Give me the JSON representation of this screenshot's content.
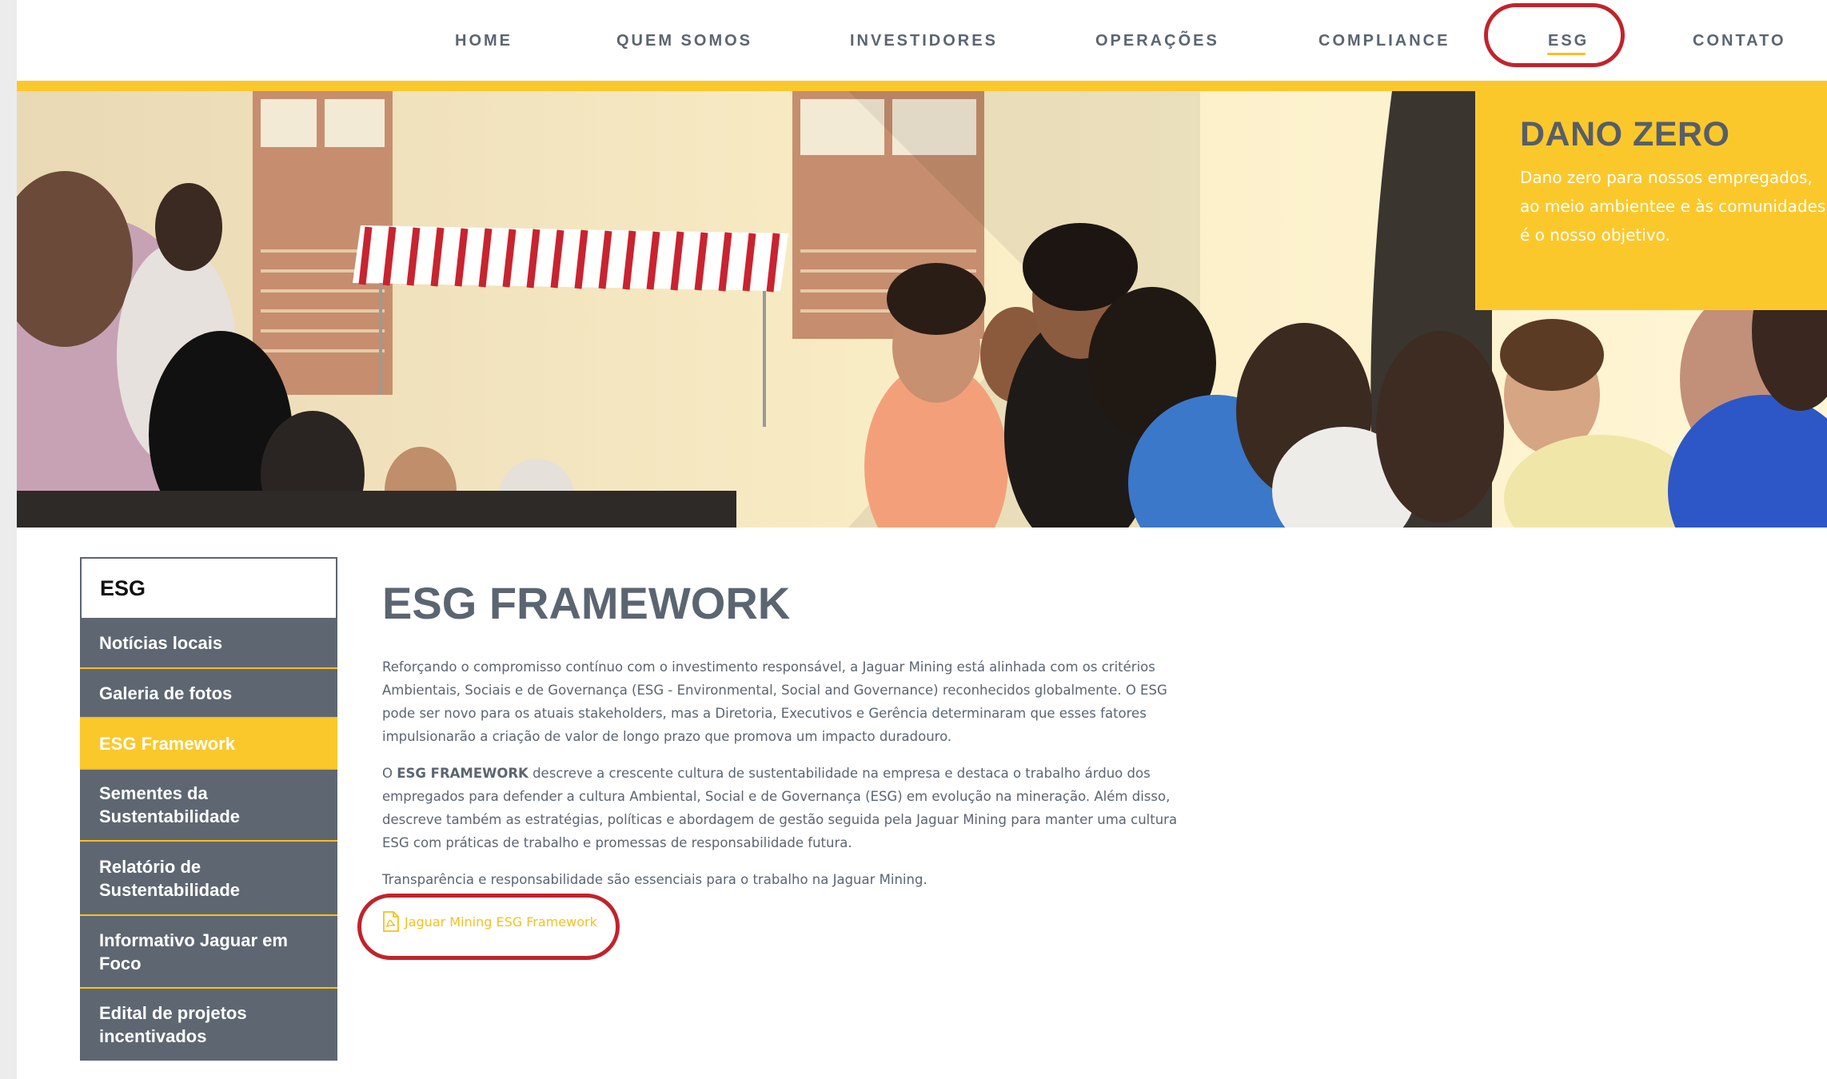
{
  "nav": {
    "items": [
      "HOME",
      "QUEM SOMOS",
      "INVESTIDORES",
      "OPERAÇÕES",
      "COMPLIANCE",
      "ESG",
      "CONTATO"
    ],
    "active": "ESG"
  },
  "colors": {
    "accent": "#fbc82c",
    "sidebar": "#5e6771",
    "text": "#5b6572",
    "annotation": "#c1232b"
  },
  "hero": {
    "title": "DANO ZERO",
    "text": "Dano zero para nossos empregados, ao meio ambientee e às comunidades é o nosso objetivo."
  },
  "sidebar": {
    "title": "ESG",
    "items": [
      {
        "label": "Notícias locais"
      },
      {
        "label": "Galeria de fotos"
      },
      {
        "label": "ESG Framework",
        "active": true
      },
      {
        "label": "Sementes da Sustentabilidade"
      },
      {
        "label": "Relatório de Sustentabilidade"
      },
      {
        "label": "Informativo Jaguar em Foco"
      },
      {
        "label": "Edital de projetos incentivados"
      }
    ]
  },
  "main": {
    "title": "ESG FRAMEWORK",
    "para1": "Reforçando o compromisso contínuo com o investimento responsável, a Jaguar Mining está alinhada com os critérios Ambientais, Sociais e de Governança (ESG - Environmental, Social and Governance) reconhecidos globalmente. O ESG pode ser novo para os atuais stakeholders, mas a Diretoria, Executivos e Gerência determinaram que esses fatores impulsionarão a criação de valor de longo prazo que promova um impacto duradouro.",
    "para2_prefix": "O ",
    "para2_bold": "ESG FRAMEWORK",
    "para2_rest": " descreve a crescente cultura de sustentabilidade na empresa e destaca o trabalho árduo dos empregados para defender a cultura Ambiental, Social e de Governança (ESG) em evolução na mineração. Além disso, descreve também as estratégias, políticas e abordagem de gestão seguida pela Jaguar Mining para manter uma cultura ESG com práticas de trabalho e promessas de responsabilidade futura.",
    "para3": "Transparência e responsabilidade são essenciais para o trabalho na Jaguar Mining.",
    "pdf_link": "Jaguar Mining ESG Framework",
    "pdf_icon": "pdf-file-icon"
  }
}
